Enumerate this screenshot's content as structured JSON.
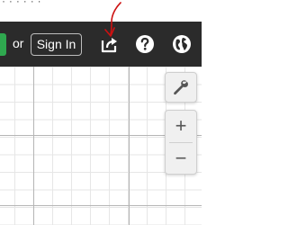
{
  "top_strip": {
    "text": "· · · · · ·"
  },
  "toolbar": {
    "or_label": "or",
    "signin_label": "Sign In",
    "icons": {
      "share": "share-icon",
      "help": "help-icon",
      "language": "globe-icon"
    }
  },
  "tools": {
    "settings_icon": "wrench-icon",
    "zoom_in_label": "+",
    "zoom_out_label": "−"
  },
  "colors": {
    "toolbar_bg": "#2b2b2b",
    "accent_green": "#2fa84f",
    "annotation_red": "#cc1111",
    "grid_major": "#b5b5b5",
    "grid_minor": "#e6e6e6"
  }
}
